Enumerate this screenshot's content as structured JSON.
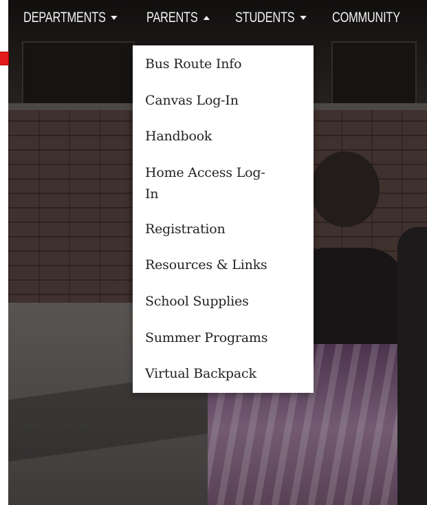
{
  "nav": {
    "items": [
      {
        "label": "DEPARTMENTS",
        "caret": "down"
      },
      {
        "label": "PARENTS",
        "caret": "up"
      },
      {
        "label": "STUDENTS",
        "caret": "down"
      },
      {
        "label": "COMMUNITY",
        "caret": "none"
      }
    ]
  },
  "dropdown": {
    "items": [
      {
        "label": "Bus Route Info"
      },
      {
        "label": "Canvas Log-In"
      },
      {
        "label": "Handbook"
      },
      {
        "label": "Home Access Log-\nIn"
      },
      {
        "label": "Registration"
      },
      {
        "label": "Resources & Links"
      },
      {
        "label": "School Supplies"
      },
      {
        "label": "Summer Programs"
      },
      {
        "label": "Virtual Backpack"
      }
    ]
  },
  "colors": {
    "accent": "#e31b1b",
    "nav_text": "#f2f2f2",
    "dropdown_bg": "#ffffff",
    "dropdown_text": "#222222"
  },
  "icons": [
    "chevron-down-icon",
    "chevron-up-icon"
  ]
}
